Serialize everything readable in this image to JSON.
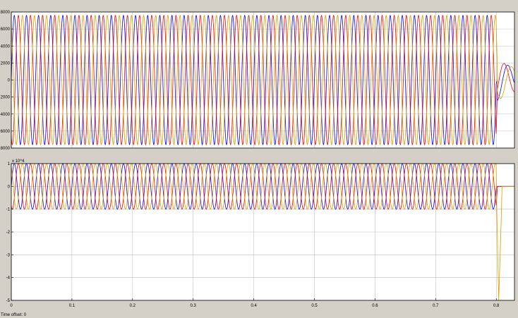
{
  "footer": {
    "label": "Time offset:",
    "value": "0"
  },
  "colors": {
    "background": "#d4d0c8",
    "axes_bg": "#ffffff",
    "grid": "#c0c0c0",
    "blue": "#1010f0",
    "red": "#f01010",
    "yellow": "#e0a000"
  },
  "chart_data": [
    {
      "type": "line",
      "title": "",
      "xlabel": "",
      "ylabel": "",
      "xlim": [
        0,
        0.83
      ],
      "ylim": [
        -8000,
        8000
      ],
      "yticks": [
        8000,
        6000,
        4000,
        2000,
        0,
        -2000,
        -4000,
        -6000,
        -8000
      ],
      "ytick_labels": [
        "8000",
        "6000",
        "4000",
        "2000",
        "0",
        "2000",
        "4000",
        "6000",
        "8000"
      ],
      "grid": true,
      "waveform": {
        "amplitude": 7600,
        "frequency_hz": 50,
        "phases": 3,
        "t_end": 0.8
      },
      "series": [
        {
          "color": "blue",
          "phase_deg": 0
        },
        {
          "color": "red",
          "phase_deg": -120
        },
        {
          "color": "yellow",
          "phase_deg": 120
        }
      ],
      "after_t_end": {
        "description": "decaying oscillation",
        "amplitude": 2400
      }
    },
    {
      "type": "line",
      "title": "",
      "xlabel": "",
      "ylabel": "",
      "xlim": [
        0,
        0.83
      ],
      "ylim": [
        -5,
        1
      ],
      "y_exponent": "x 10^4",
      "yticks": [
        1,
        0,
        -1,
        -2,
        -3,
        -4,
        -5
      ],
      "ytick_labels": [
        "1",
        "0",
        "-1",
        "-2",
        "-3",
        "-4",
        "-5"
      ],
      "xticks": [
        0,
        0.1,
        0.2,
        0.3,
        0.4,
        0.5,
        0.6,
        0.7,
        0.8
      ],
      "xtick_labels": [
        "0",
        "0.1",
        "0.2",
        "0.3",
        "0.4",
        "0.5",
        "0.6",
        "0.7",
        "0.8"
      ],
      "grid": true,
      "waveform": {
        "amplitude": 1.0,
        "frequency_hz": 50,
        "phases": 3,
        "t_end": 0.8
      },
      "series": [
        {
          "color": "blue",
          "phase_deg": 0
        },
        {
          "color": "red",
          "phase_deg": -120
        },
        {
          "color": "yellow",
          "phase_deg": 120
        }
      ],
      "after_t_end": {
        "description": "yellow spike to -5, then flat at 0",
        "min": -5
      }
    }
  ]
}
